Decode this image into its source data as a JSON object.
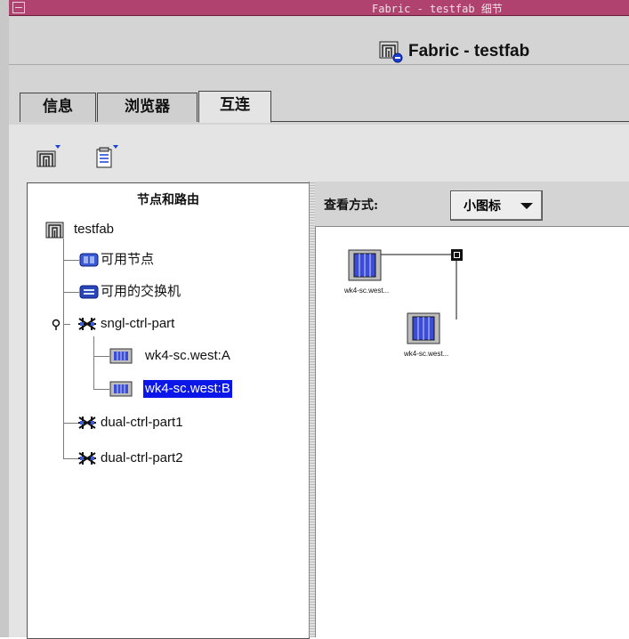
{
  "window": {
    "title": "Fabric - testfab 细节"
  },
  "header": {
    "title": "Fabric - testfab",
    "icon": "fabric-icon"
  },
  "tabs": [
    {
      "label": "信息",
      "active": false
    },
    {
      "label": "浏览器",
      "active": false
    },
    {
      "label": "互连",
      "active": true
    }
  ],
  "toolbar": {
    "buttons": [
      {
        "icon": "fabric-menu-icon"
      },
      {
        "icon": "document-menu-icon"
      }
    ]
  },
  "tree": {
    "header": "节点和路由",
    "root": {
      "label": "testfab",
      "icon": "fabric-icon"
    },
    "items": [
      {
        "label": "可用节点",
        "icon": "node-pool-icon"
      },
      {
        "label": "可用的交换机",
        "icon": "switch-pool-icon"
      },
      {
        "label": "sngl-ctrl-part",
        "icon": "partition-icon",
        "expanded": true
      },
      {
        "label": "wk4-sc.west:A",
        "icon": "node-icon"
      },
      {
        "label": "wk4-sc.west:B",
        "icon": "node-icon",
        "selected": true
      },
      {
        "label": "dual-ctrl-part1",
        "icon": "partition-icon"
      },
      {
        "label": "dual-ctrl-part2",
        "icon": "partition-icon"
      }
    ]
  },
  "view": {
    "label": "查看方式:",
    "selected": "小图标",
    "options": [
      "小图标"
    ]
  },
  "graph": {
    "nodes": [
      {
        "label": "wk4-sc.west..."
      },
      {
        "label": "wk4-sc.west..."
      }
    ]
  },
  "colors": {
    "titlebar": "#b0426f",
    "selection": "#0a17e8",
    "panel": "#d4d4d4"
  }
}
